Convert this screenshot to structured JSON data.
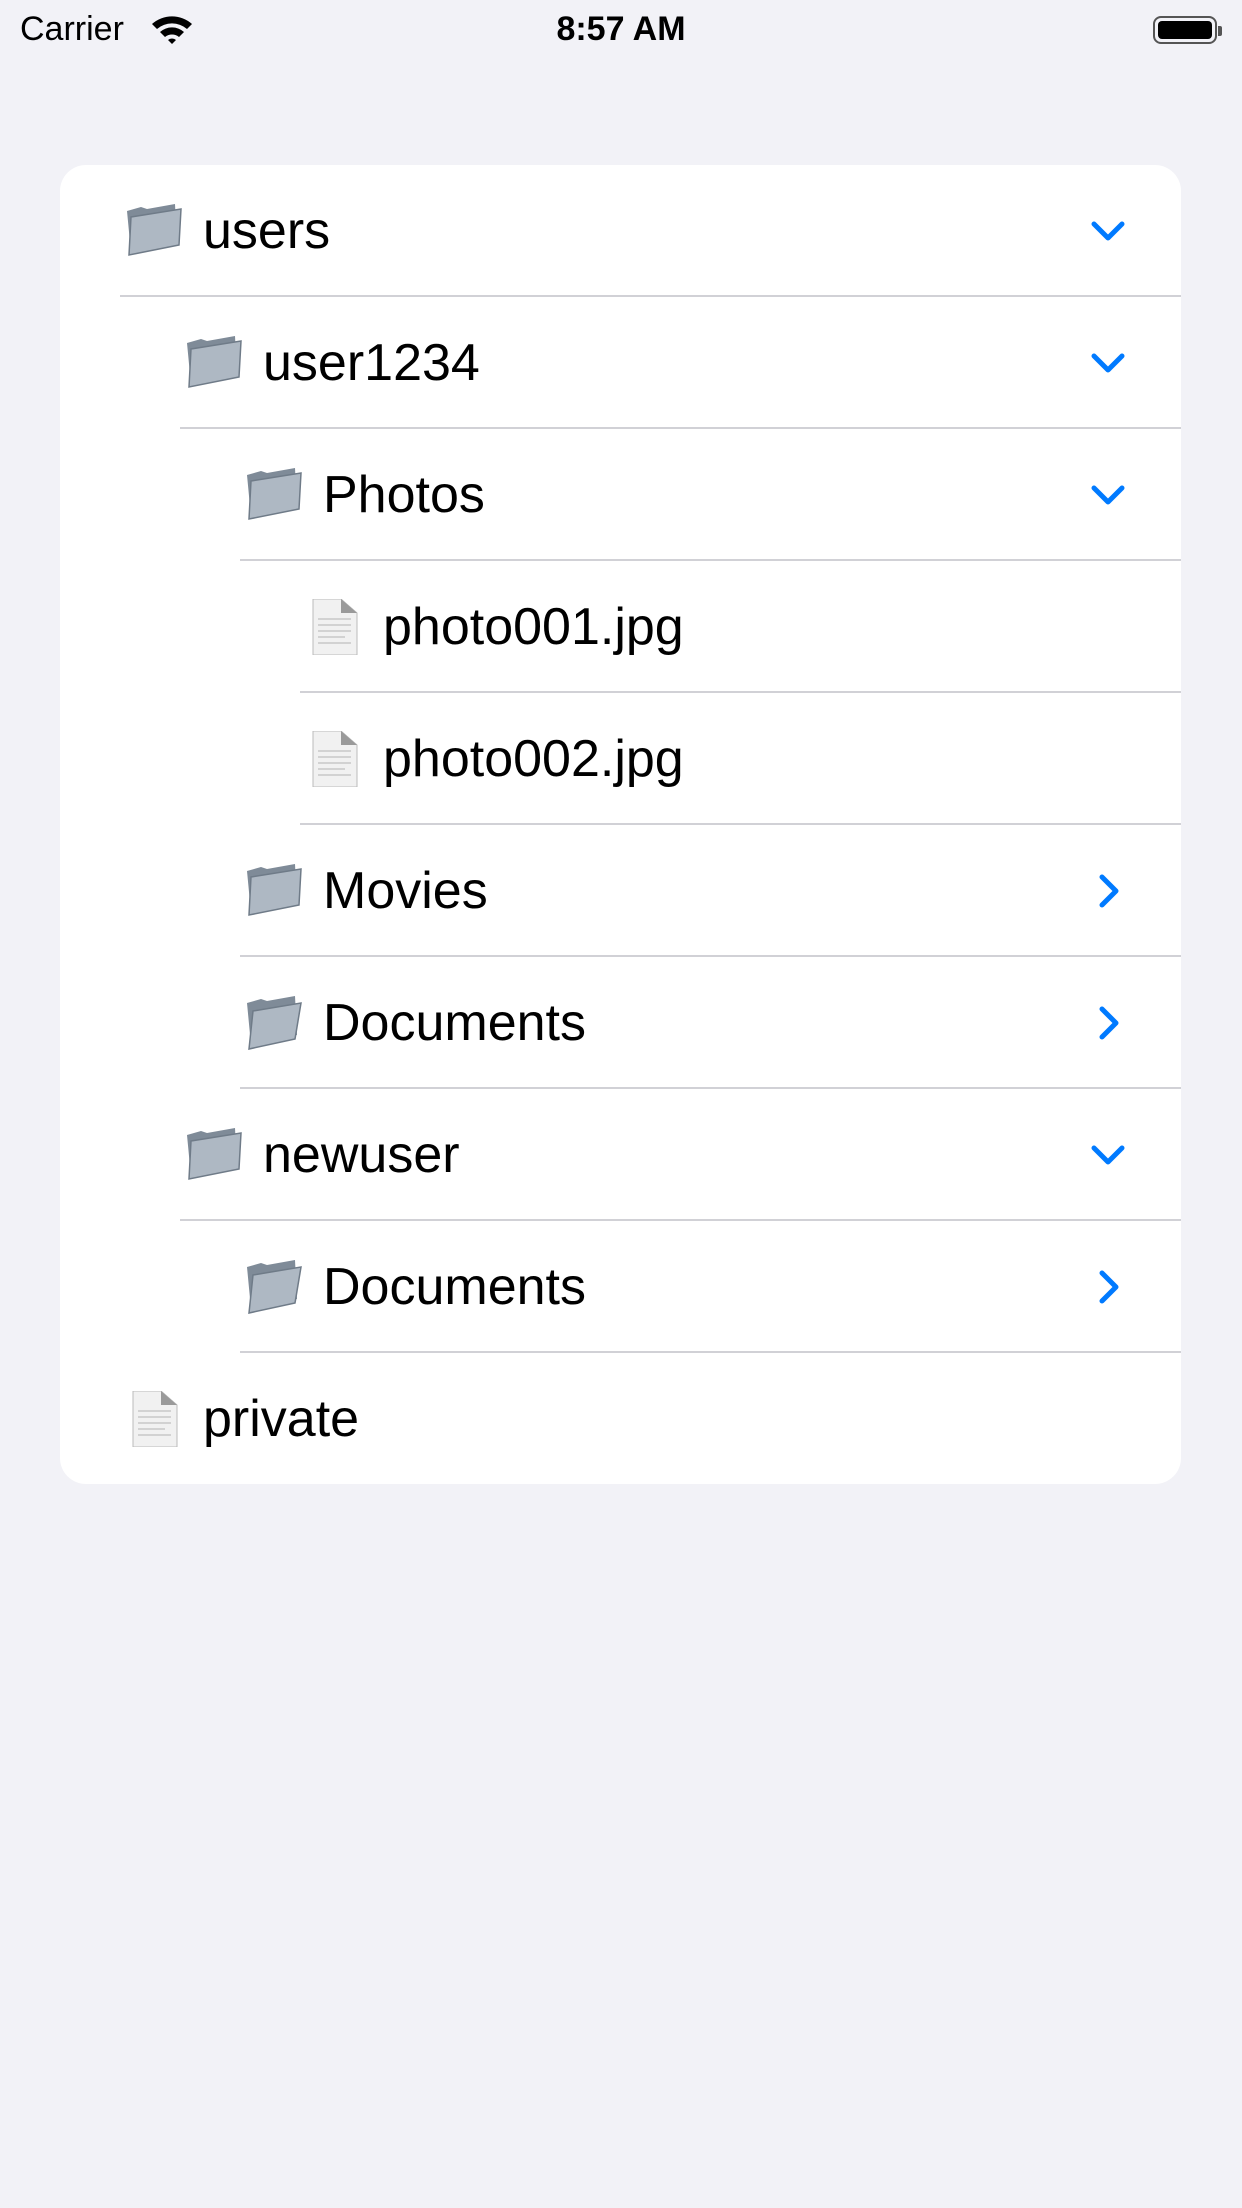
{
  "status_bar": {
    "carrier": "Carrier",
    "time": "8:57 AM",
    "battery_level": 1.0
  },
  "accent_color": "#007aff",
  "tree": [
    {
      "label": "users",
      "level": 0,
      "icon": "folder-icon",
      "state": "expanded"
    },
    {
      "label": "user1234",
      "level": 1,
      "icon": "folder-icon",
      "state": "expanded"
    },
    {
      "label": "Photos",
      "level": 2,
      "icon": "folder-icon",
      "state": "expanded"
    },
    {
      "label": "photo001.jpg",
      "level": 3,
      "icon": "file-icon",
      "state": "leaf"
    },
    {
      "label": "photo002.jpg",
      "level": 3,
      "icon": "file-icon",
      "state": "leaf"
    },
    {
      "label": "Movies",
      "level": 2,
      "icon": "folder-icon",
      "state": "collapsed"
    },
    {
      "label": "Documents",
      "level": 2,
      "icon": "open-folder-icon",
      "state": "collapsed"
    },
    {
      "label": "newuser",
      "level": 1,
      "icon": "folder-icon",
      "state": "expanded"
    },
    {
      "label": "Documents",
      "level": 2,
      "icon": "open-folder-icon",
      "state": "collapsed"
    },
    {
      "label": "private",
      "level": 0,
      "icon": "file-icon",
      "state": "leaf"
    }
  ]
}
